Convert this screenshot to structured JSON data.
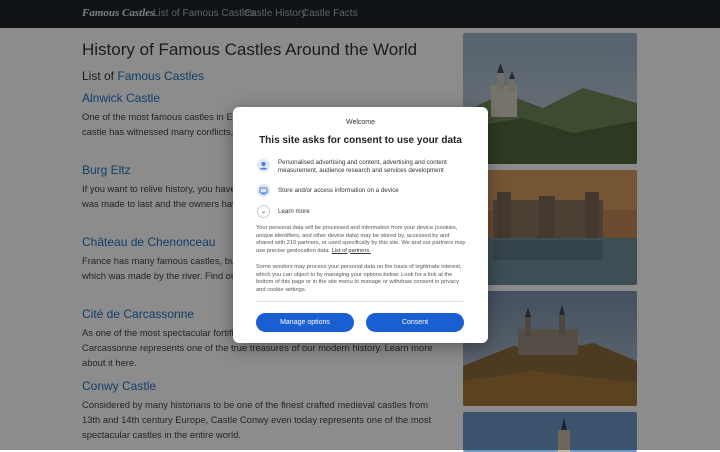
{
  "nav": {
    "brand": "Famous Castles",
    "links": [
      "List of Famous Castles",
      "Castle History",
      "Castle Facts"
    ]
  },
  "page": {
    "title": "History of Famous Castles Around the World",
    "list_prefix": "List of ",
    "list_link": "Famous Castles"
  },
  "castles": [
    {
      "title": "Alnwick Castle",
      "text": "One of the most famous castles in England, Alnwick. Created in the 11th century, this castle has witnessed many conflicts, raids, and sieges. Here is its story."
    },
    {
      "title": "Burg Eltz",
      "text": "If you want to relive history, you have to visit this castle with its 800-year long history. It was made to last and the owners have opened part of the castle to tourists."
    },
    {
      "title": "Château de Chenonceau",
      "text": "France has many famous castles, but none of them is like Chenonceau, beautiful castle which was made by the river. Find out more about it here."
    },
    {
      "title": "Cité de Carcassonne",
      "text": "As one of the most spectacular fortified cities in the world, France's Cité de Carcassonne represents one of the true treasures of our modern history. Learn more about it here."
    },
    {
      "title": "Conwy Castle",
      "text": "Considered by many historians to be one of the finest crafted medieval castles from 13th and 14th century Europe, Castle Conwy even today represents one of the most spectacular castles in the entire world."
    }
  ],
  "consent": {
    "welcome": "Welcome",
    "title": "This site asks for consent to use your data",
    "purposes": [
      {
        "icon": "person-icon",
        "text": "Personalised advertising and content, advertising and content measurement, audience research and services development"
      },
      {
        "icon": "device-icon",
        "text": "Store and/or access information on a device"
      }
    ],
    "learn_more": "Learn more",
    "para1": "Your personal data will be processed and information from your device (cookies, unique identifiers, and other device data) may be stored by, accessed by and shared with 210 partners, or used specifically by this site. We and our partners may use precise geolocation data.",
    "para1_link": "List of partners.",
    "para2": "Some vendors may process your personal data on the basis of legitimate interest, which you can object to by managing your options below. Look for a link at the bottom of this page or in the site menu to manage or withdraw consent in privacy and cookie settings.",
    "manage_label": "Manage options",
    "consent_label": "Consent",
    "accent": "#1a5fd1"
  }
}
